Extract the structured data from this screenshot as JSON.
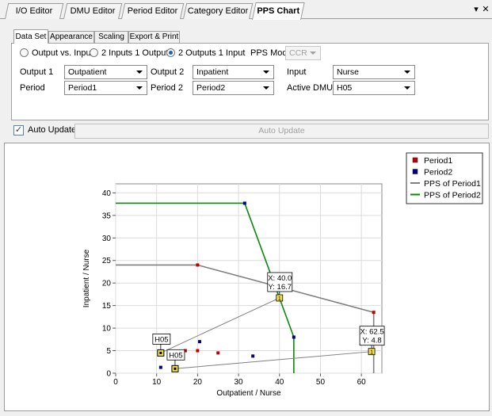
{
  "doc_tabs": [
    {
      "label": "I/O Editor",
      "active": false
    },
    {
      "label": "DMU Editor",
      "active": false
    },
    {
      "label": "Period Editor",
      "active": false
    },
    {
      "label": "Category Editor",
      "active": false
    },
    {
      "label": "PPS Chart",
      "active": true
    }
  ],
  "doc_tab_controls": {
    "dropdown": "▾",
    "close": "✕"
  },
  "inner_tabs": [
    {
      "label": "Data Set",
      "active": true
    },
    {
      "label": "Appearance",
      "active": false
    },
    {
      "label": "Scaling",
      "active": false
    },
    {
      "label": "Export & Print",
      "active": false
    }
  ],
  "dataset": {
    "mode_options": [
      {
        "label": "Output vs. Input",
        "selected": false
      },
      {
        "label": "2 Inputs 1 Output",
        "selected": false
      },
      {
        "label": "2 Outputs 1 Input",
        "selected": true
      }
    ],
    "pps_mode_label": "PPS Mode:",
    "pps_mode_value": "CCR",
    "output1_label": "Output 1",
    "output1_value": "Outpatient",
    "output2_label": "Output 2",
    "output2_value": "Inpatient",
    "input_label": "Input",
    "input_value": "Nurse",
    "period1_label": "Period",
    "period1_value": "Period1",
    "period2_label": "Period 2",
    "period2_value": "Period2",
    "active_dmu_label": "Active DMU",
    "active_dmu_value": "H05"
  },
  "auto_update": {
    "checkbox_label": "Auto Update",
    "checked": true,
    "button_label": "Auto Update"
  },
  "chart_data": {
    "type": "scatter",
    "xlabel": "Outpatient / Nurse",
    "ylabel": "Inpatient / Nurse",
    "xlim": [
      0,
      65
    ],
    "ylim": [
      0,
      42
    ],
    "xticks": [
      "0",
      "10",
      "20",
      "30",
      "40",
      "50",
      "60"
    ],
    "yticks": [
      "0",
      "5",
      "10",
      "15",
      "20",
      "25",
      "30",
      "35",
      "40"
    ],
    "grid": true,
    "legend_position": "top-right",
    "series": [
      {
        "name": "Period1",
        "kind": "points",
        "color": "#c00000",
        "points": [
          [
            17,
            5
          ],
          [
            20,
            5
          ],
          [
            25,
            4.5
          ],
          [
            20,
            24
          ],
          [
            63,
            13.5
          ]
        ]
      },
      {
        "name": "Period2",
        "kind": "points",
        "color": "#00008b",
        "points": [
          [
            11,
            1.3
          ],
          [
            20.5,
            7
          ],
          [
            33.5,
            3.8
          ],
          [
            31.5,
            37.7
          ],
          [
            43.5,
            8
          ]
        ]
      },
      {
        "name": "PPS of Period1",
        "kind": "line",
        "color": "#808080",
        "points": [
          [
            0,
            24
          ],
          [
            20,
            24
          ],
          [
            63,
            13.5
          ],
          [
            63,
            0
          ]
        ]
      },
      {
        "name": "PPS of Period2",
        "kind": "line",
        "color": "#0a8a0a",
        "points": [
          [
            0,
            37.7
          ],
          [
            31.5,
            37.7
          ],
          [
            43.5,
            8
          ],
          [
            43.5,
            0
          ]
        ]
      }
    ],
    "active_dmu": {
      "period1_point": [
        11,
        4.5
      ],
      "period2_point": [
        14.5,
        1.0
      ],
      "period1_label": "H05",
      "period2_label": "H05",
      "ray_color": "#808080",
      "projections": [
        {
          "x": 40.0,
          "y": 16.7,
          "label_x": "X: 40.0",
          "label_y": "Y: 16.7",
          "marker": "1"
        },
        {
          "x": 62.5,
          "y": 4.8,
          "label_x": "X: 62.5",
          "label_y": "Y: 4.8",
          "marker": "1"
        }
      ]
    }
  }
}
